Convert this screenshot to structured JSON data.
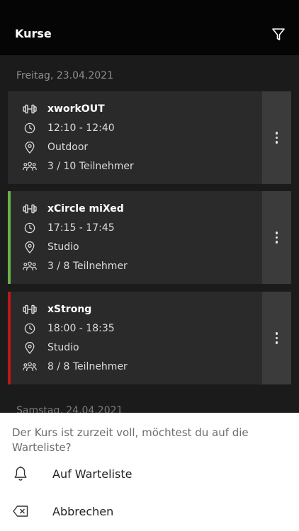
{
  "header": {
    "title": "Kurse",
    "filter_icon": "filter-icon"
  },
  "days": [
    {
      "date": "Freitag, 23.04.2021",
      "courses": [
        {
          "name": "xworkOUT",
          "time": "12:10 - 12:40",
          "location": "Outdoor",
          "participants": "3 / 10 Teilnehmer",
          "accent": ""
        },
        {
          "name": "xCircle miXed",
          "time": "17:15 - 17:45",
          "location": "Studio",
          "participants": "3 / 8 Teilnehmer",
          "accent": "#6ab04c"
        },
        {
          "name": "xStrong",
          "time": "18:00 - 18:35",
          "location": "Studio",
          "participants": "8 / 8 Teilnehmer",
          "accent": "#c0161b"
        }
      ]
    },
    {
      "date": "Samstag, 24.04.2021"
    }
  ],
  "sheet": {
    "message": "Der Kurs ist zurzeit voll, möchtest du auf die Warteliste?",
    "actions": [
      {
        "label": "Auf Warteliste",
        "icon": "bell-icon"
      },
      {
        "label": "Abbrechen",
        "icon": "cancel-icon"
      }
    ]
  },
  "colors": {
    "background": "#1b1b1b",
    "card": "#2a2a2a",
    "menu": "#3b3b3b",
    "header": "#050505",
    "full": "#c0161b",
    "available": "#6ab04c"
  }
}
